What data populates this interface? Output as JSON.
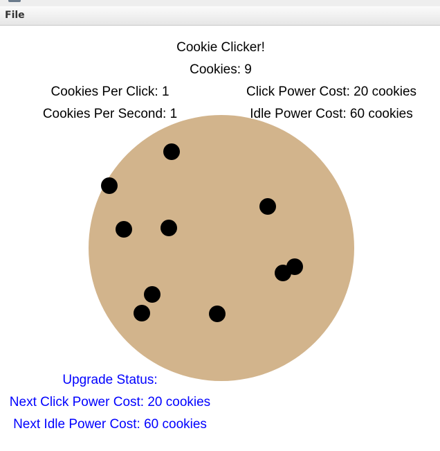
{
  "menu": {
    "file_label": "File"
  },
  "game": {
    "title": "Cookie Clicker!",
    "cookies": "Cookies: 9",
    "cookies_per_click": "Cookies Per Click: 1",
    "cookies_per_second": "Cookies Per Second: 1",
    "click_power_cost": "Click Power Cost: 20 cookies",
    "idle_power_cost": "Idle Power Cost: 60 cookies"
  },
  "upgrade": {
    "status_label": "Upgrade Status:",
    "next_click_cost": "Next Click Power Cost: 20 cookies",
    "next_idle_cost": "Next Idle Power Cost: 60 cookies"
  },
  "colors": {
    "cookie": "#d2b48c",
    "chip": "#000000",
    "status_text": "#0000ff"
  },
  "icons": {
    "cookie": "cookie-icon",
    "chip": "chocolate-chip-icon"
  }
}
